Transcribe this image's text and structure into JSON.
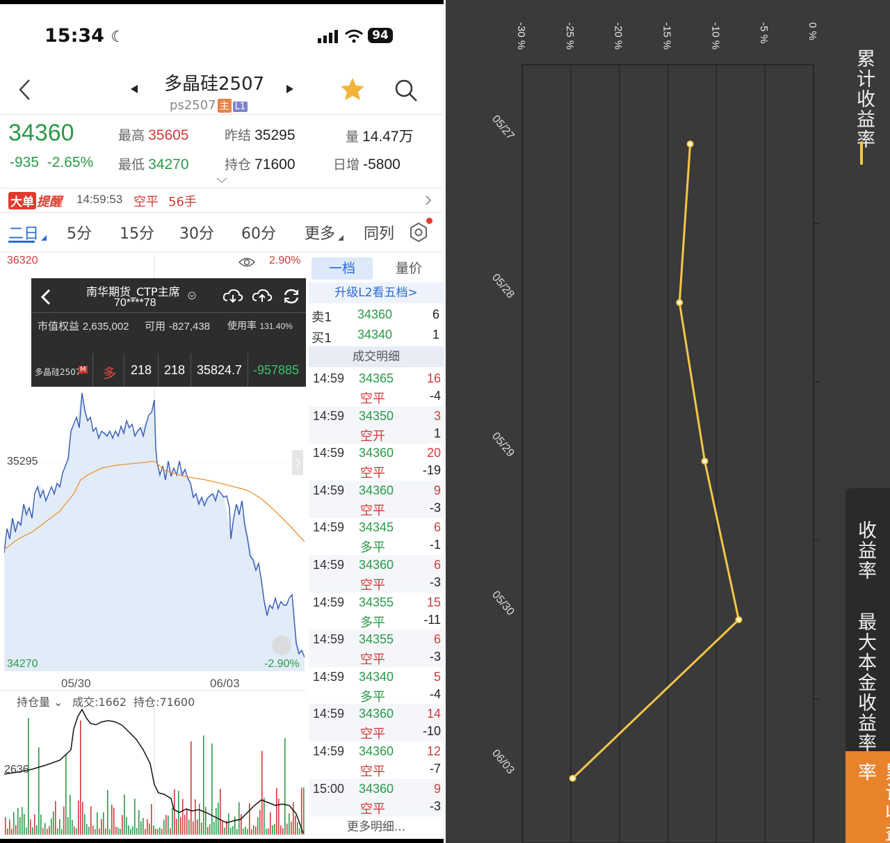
{
  "status_bar": {
    "time": "15:34",
    "moon_icon": "moon-icon",
    "battery": "94"
  },
  "header": {
    "title": "多晶硅2507",
    "code": "ps2507",
    "tag_main": "主",
    "tag_level": "L1"
  },
  "quote": {
    "last_price": "34360",
    "change": "-935",
    "change_pct": "-2.65%",
    "high_label": "最高",
    "high": "35605",
    "low_label": "最低",
    "low": "34270",
    "prev_settle_label": "昨结",
    "prev_settle": "35295",
    "open_interest_label": "持仓",
    "open_interest": "71600",
    "volume_label": "量",
    "volume": "14.47万",
    "daily_inc_label": "日增",
    "daily_inc": "-5800"
  },
  "alert": {
    "badge_a": "大单",
    "badge_b": "提醒",
    "time": "14:59:53",
    "type": "空平",
    "qty": "56手"
  },
  "tabs": [
    "二日",
    "5分",
    "15分",
    "30分",
    "60分",
    "更多",
    "同列"
  ],
  "chart": {
    "top_price": "36320",
    "top_pct": "2.90%",
    "mid_price": "35295",
    "bottom_price": "34270",
    "bottom_pct": "-2.90%",
    "date_left": "05/30",
    "date_right": "06/03",
    "sub_indicator": "持仓量",
    "sub_volume": "成交:1662",
    "sub_oi": "持仓:71600",
    "sub_axis_label": "2636"
  },
  "account_overlay": {
    "broker": "南华期货_CTP主席",
    "account": "70****78",
    "equity_label": "市值权益",
    "equity": "2,635,002",
    "available_label": "可用",
    "available": "-827,438",
    "usage_label": "使用率",
    "usage": "131.40%",
    "position": {
      "name": "多晶硅2507",
      "tag": "M",
      "direction": "多",
      "qty": "218",
      "avail_qty": "218",
      "avg_price": "35824.7",
      "pnl": "-957885"
    }
  },
  "order_book": {
    "tab_active": "一档",
    "tab_other": "量价",
    "upgrade_link": "升级L2看五档>",
    "ask_label": "卖1",
    "ask_price": "34360",
    "ask_qty": "6",
    "bid_label": "买1",
    "bid_price": "34340",
    "bid_qty": "1",
    "trades_header": "成交明细",
    "more_link": "更多明细..."
  },
  "trades": [
    {
      "time": "14:59",
      "price": "34365",
      "vol": "16",
      "type": "空平",
      "oi": "-4"
    },
    {
      "time": "14:59",
      "price": "34350",
      "vol": "3",
      "type": "空开",
      "oi": "1"
    },
    {
      "time": "14:59",
      "price": "34360",
      "vol": "20",
      "type": "空平",
      "oi": "-19"
    },
    {
      "time": "14:59",
      "price": "34360",
      "vol": "9",
      "type": "空平",
      "oi": "-3"
    },
    {
      "time": "14:59",
      "price": "34345",
      "vol": "6",
      "type": "多平",
      "oi": "-1"
    },
    {
      "time": "14:59",
      "price": "34360",
      "vol": "6",
      "type": "空平",
      "oi": "-3"
    },
    {
      "time": "14:59",
      "price": "34355",
      "vol": "15",
      "type": "多平",
      "oi": "-11"
    },
    {
      "time": "14:59",
      "price": "34355",
      "vol": "6",
      "type": "空平",
      "oi": "-3"
    },
    {
      "time": "14:59",
      "price": "34340",
      "vol": "5",
      "type": "多平",
      "oi": "-4"
    },
    {
      "time": "14:59",
      "price": "34360",
      "vol": "14",
      "type": "空平",
      "oi": "-10"
    },
    {
      "time": "14:59",
      "price": "34360",
      "vol": "12",
      "type": "空平",
      "oi": "-7"
    },
    {
      "time": "15:00",
      "price": "34360",
      "vol": "9",
      "type": "空平",
      "oi": "-3"
    }
  ],
  "colors": {
    "up": "#d23b3b",
    "down": "#2a9a48",
    "accent": "#2b6bd1",
    "line_yellow": "#f4c64a",
    "dark_bg": "#3a3a3a",
    "orange_tab": "#e8832c"
  },
  "returns_panel": {
    "legend_label": "累计收益率",
    "side_tabs": [
      "收益率",
      "最大本金收益率",
      "累计收益率"
    ],
    "chart_data": {
      "type": "line",
      "x": [
        "05/27",
        "05/28",
        "05/29",
        "05/30",
        "06/03"
      ],
      "series": [
        {
          "name": "累计收益率",
          "values": [
            -12.7,
            -13.8,
            -11.2,
            -7.7,
            -24.8
          ]
        }
      ],
      "value_axis_ticks": [
        "-30 %",
        "-25 %",
        "-20 %",
        "-15 %",
        "-10 %",
        "-5 %",
        "0 %"
      ],
      "ylim": [
        -30,
        0
      ]
    }
  }
}
